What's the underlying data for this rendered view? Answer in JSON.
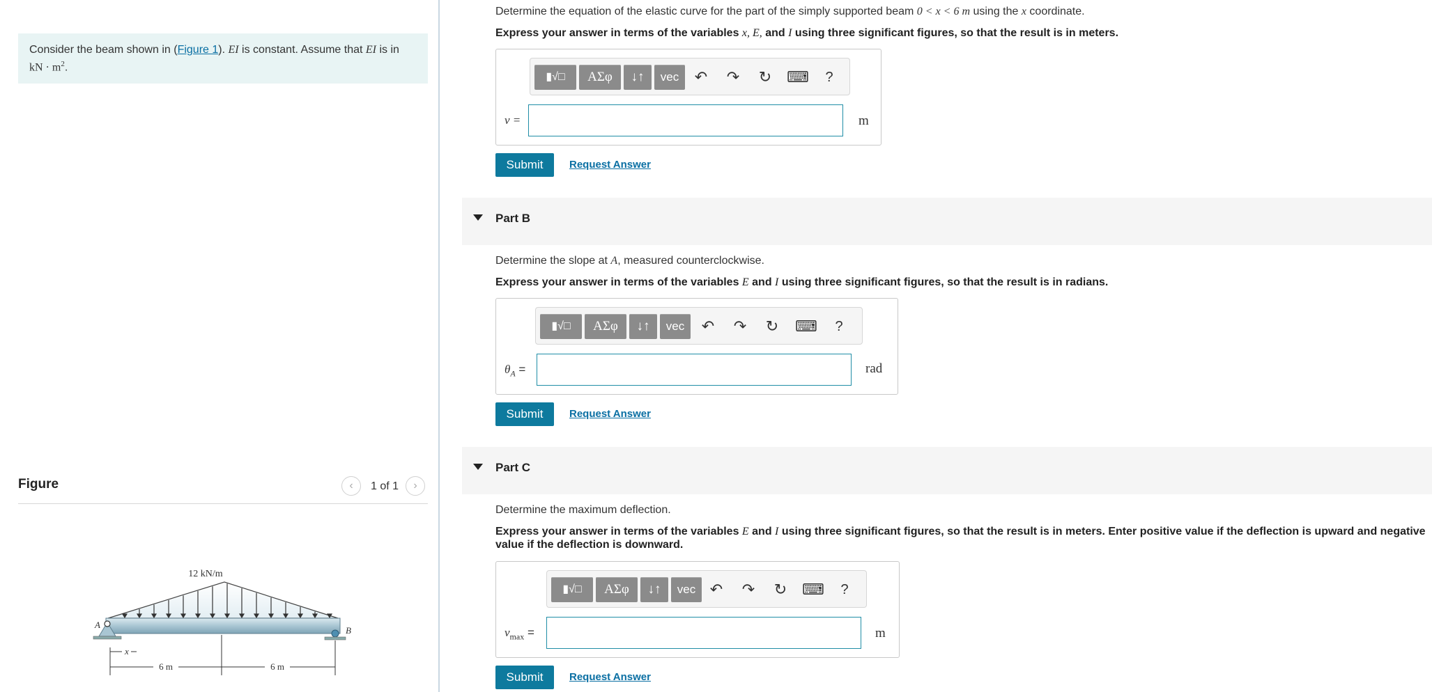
{
  "problem": {
    "text_before": "Consider the beam shown in (",
    "link": "Figure 1",
    "text_after": "). ",
    "ei": "EI",
    "text_mid": " is constant. Assume that ",
    "ei2": "EI",
    "text_end": " is in",
    "units": "kN · m",
    "units_exp": "2",
    "units_period": "."
  },
  "figure": {
    "title": "Figure",
    "pager": "1 of 1",
    "load_label": "12 kN/m",
    "label_a": "A",
    "label_b": "B",
    "label_x": "x",
    "dim_left": "6 m",
    "dim_right": "6 m"
  },
  "partA": {
    "prompt_pre": "Determine the equation of the elastic curve for the part of the simply supported beam ",
    "prompt_math": "0 < x < 6 m",
    "prompt_mid": " using the ",
    "prompt_x": "x",
    "prompt_post": " coordinate.",
    "instr_pre": "Express your answer in terms of the variables ",
    "instr_vars": "x, E,",
    "instr_and": " and ",
    "instr_i": "I",
    "instr_post": " using three significant figures, so that the result is in meters.",
    "var": "v =",
    "unit": "m",
    "submit": "Submit",
    "request": "Request Answer"
  },
  "partB": {
    "title": "Part B",
    "prompt_pre": "Determine the slope at ",
    "prompt_a": "A",
    "prompt_post": ", measured counterclockwise.",
    "instr_pre": "Express your answer in terms of the variables ",
    "instr_e": "E",
    "instr_and": " and ",
    "instr_i": "I",
    "instr_post": " using three significant figures, so that the result is in radians.",
    "var": "θ",
    "var_sub": "A",
    "var_eq": " =",
    "unit": "rad",
    "submit": "Submit",
    "request": "Request Answer"
  },
  "partC": {
    "title": "Part C",
    "prompt": "Determine the maximum deflection.",
    "instr_pre": "Express your answer in terms of the variables ",
    "instr_e": "E",
    "instr_and": " and ",
    "instr_i": "I",
    "instr_post": " using three significant figures, so that the result is in meters. Enter positive value if the deflection is upward and negative",
    "instr_line2": "value if the deflection is downward.",
    "var": "v",
    "var_sub": "max",
    "var_eq": " =",
    "unit": "m",
    "submit": "Submit",
    "request": "Request Answer"
  },
  "toolbar": {
    "templates": "▮√□",
    "greek": "ΑΣφ",
    "arrows": "↓↑",
    "vec": "vec",
    "undo": "↶",
    "redo": "↷",
    "reset": "↻",
    "keyboard": "⌨",
    "help": "?"
  }
}
